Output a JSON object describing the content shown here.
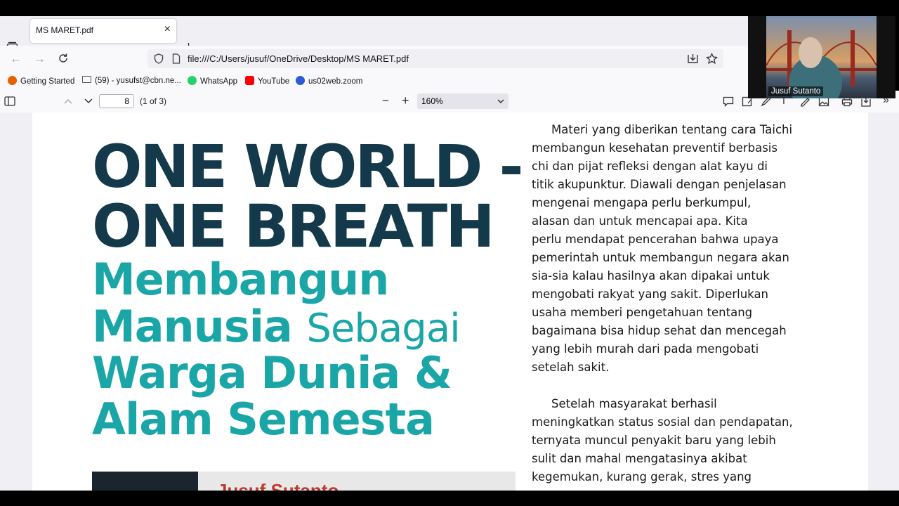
{
  "tab": {
    "title": "MS MARET.pdf"
  },
  "navigation": {
    "url": "file:///C:/Users/jusuf/OneDrive/Desktop/MS MARET.pdf"
  },
  "bookmarks": [
    {
      "label": "Getting Started",
      "icon": "firefox-icon",
      "color": "#e66000"
    },
    {
      "label": "(59) - yusufst@cbn.ne...",
      "icon": "mail-icon",
      "color": "#555555"
    },
    {
      "label": "WhatsApp",
      "icon": "whatsapp-icon",
      "color": "#25d366"
    },
    {
      "label": "YouTube",
      "icon": "youtube-icon",
      "color": "#ff0000"
    },
    {
      "label": "us02web.zoom",
      "icon": "zoom-icon",
      "color": "#2d5bd6"
    }
  ],
  "pdf_toolbar": {
    "page_number": "8",
    "page_count": "(1 of 3)",
    "zoom": "160%"
  },
  "document": {
    "headline_lines": [
      "ONE WORLD -",
      "ONE BREATH"
    ],
    "subhead_lines": [
      {
        "strong": "Membangun",
        "light": ""
      },
      {
        "strong": "Manusia",
        "light": "Sebagai"
      },
      {
        "strong": "Warga Dunia &",
        "light": ""
      },
      {
        "strong": "Alam Semesta",
        "light": ""
      }
    ],
    "author": "Jusuf Sutanto",
    "paragraph1": [
      "Materi yang diberikan tentang cara Taichi",
      "membangun kesehatan preventif berbasis",
      "chi dan pijat refleksi dengan alat kayu di",
      "titik akupunktur. Diawali dengan penjelasan",
      "mengenai mengapa perlu berkumpul,",
      "alasan dan untuk mencapai apa. Kita",
      "perlu mendapat pencerahan bahwa upaya",
      "pemerintah untuk membangun negara akan",
      "sia-sia kalau hasilnya akan dipakai untuk",
      "mengobati rakyat yang sakit. Diperlukan",
      "usaha memberi pengetahuan tentang",
      "bagaimana bisa hidup sehat dan mencegah",
      "yang lebih murah dari pada mengobati",
      "setelah sakit."
    ],
    "paragraph2": [
      "Setelah masyarakat berhasil",
      "meningkatkan status sosial dan pendapatan,",
      "ternyata muncul penyakit baru yang lebih",
      "sulit dan mahal mengatasinya akibat",
      "kegemukan, kurang gerak, stres yang"
    ]
  },
  "video_call": {
    "participant_name": "Jusuf Sutanto"
  }
}
